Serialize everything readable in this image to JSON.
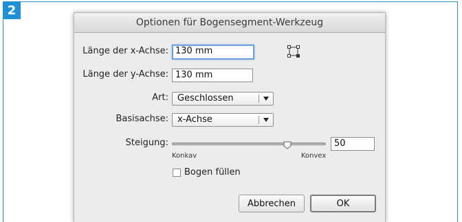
{
  "step_number": "2",
  "dialog": {
    "title": "Optionen für Bogensegment-Werkzeug",
    "x_axis": {
      "label": "Länge der x-Achse:",
      "value": "130 mm"
    },
    "y_axis": {
      "label": "Länge der y-Achse:",
      "value": "130 mm"
    },
    "type": {
      "label": "Art:",
      "selected": "Geschlossen"
    },
    "base_axis": {
      "label": "Basisachse:",
      "selected": "x-Achse"
    },
    "slope": {
      "label": "Steigung:",
      "value": "50",
      "level": 0.75,
      "min_label": "Konkav",
      "max_label": "Konvex"
    },
    "fill_arc": {
      "label": "Bogen füllen",
      "checked": false
    },
    "buttons": {
      "cancel": "Abbrechen",
      "ok": "OK"
    },
    "icons": {
      "origin_locator": "origin-point-locator-icon"
    }
  }
}
